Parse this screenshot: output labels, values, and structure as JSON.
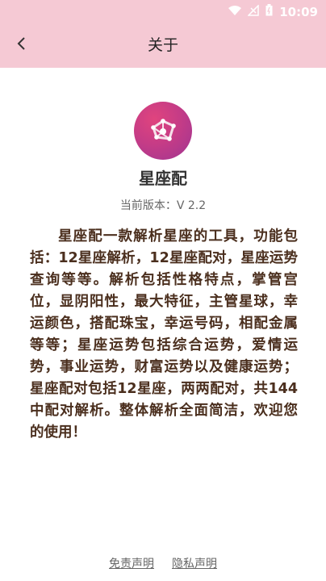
{
  "status_bar": {
    "time": "10:09",
    "icons": [
      "wifi-icon",
      "no-signal-icon",
      "battery-icon"
    ]
  },
  "toolbar": {
    "back_icon": "chevron-left-icon",
    "title": "关于"
  },
  "app": {
    "name": "星座配",
    "version": "当前版本：V 2.2",
    "description": "星座配一款解析星座的工具，功能包括：12星座解析，12星座配对，星座运势查询等等。解析包括性格特点，掌管宫位，显阴阳性，最大特征，主管星球，幸运颜色，搭配珠宝，幸运号码，相配金属等等；星座运势包括综合运势，爱情运势，事业运势，财富运势以及健康运势；星座配对包括12星座，两两配对，共144中配对解析。整体解析全面简洁，欢迎您的使用！"
  },
  "footer": {
    "disclaimer": "免责声明",
    "privacy": "隐私声明"
  },
  "colors": {
    "toolbar_bg": "#f5c9d4",
    "logo_gradient_start": "#e0447e",
    "logo_gradient_end": "#9f3592",
    "description_text": "#4b2f1e"
  }
}
